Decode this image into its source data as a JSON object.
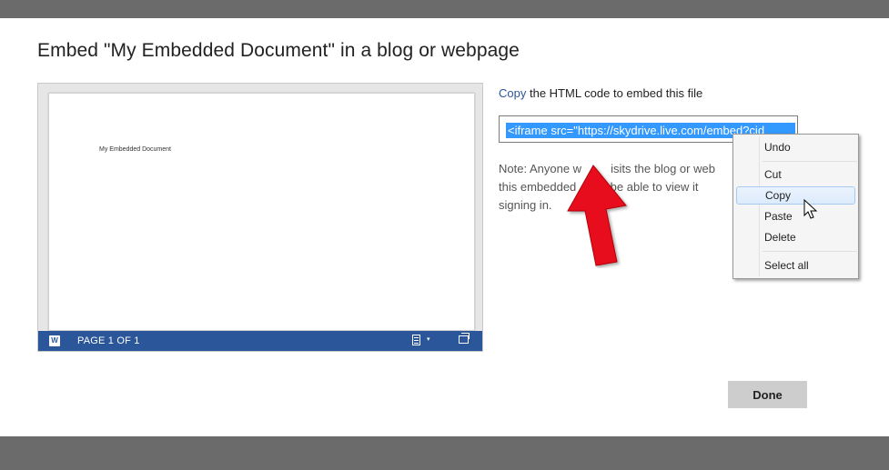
{
  "dialog": {
    "title": "Embed \"My Embedded Document\" in a blog or webpage",
    "done_label": "Done"
  },
  "preview": {
    "document_text": "My Embedded Document",
    "status_page": "PAGE 1 OF 1",
    "word_icon_text": "W",
    "status_color": "#2b579a"
  },
  "embed": {
    "copy_link": "Copy",
    "copy_text": " the HTML code to embed this file",
    "code": "<iframe src=\"https://skydrive.live.com/embed?cid",
    "note_prefix": "Note: Anyone w",
    "note_middle1": "isits the blog or web",
    "note_middle2": "this embedded",
    "note_middle3": "ll be able to view it",
    "note_end": "signing in.",
    "selection_color": "#3399ff"
  },
  "context_menu": {
    "items": [
      {
        "label": "Undo"
      },
      {
        "label": "Cut"
      },
      {
        "label": "Copy",
        "highlighted": true
      },
      {
        "label": "Paste"
      },
      {
        "label": "Delete"
      },
      {
        "label": "Select all"
      }
    ]
  },
  "annotation": {
    "arrow_color": "#e8111b"
  }
}
